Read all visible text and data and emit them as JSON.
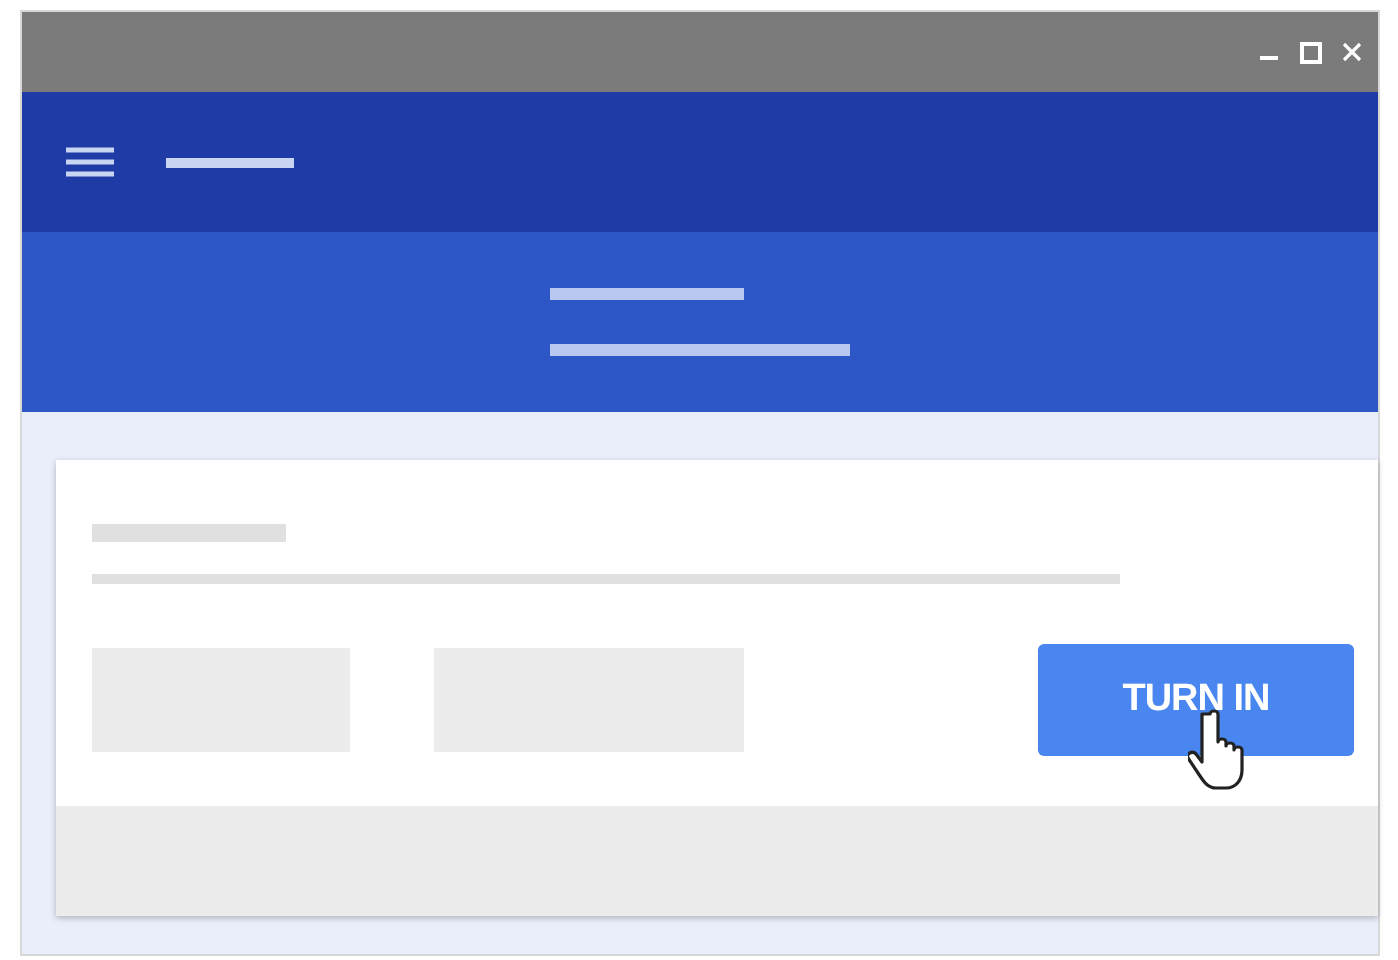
{
  "assignment_card": {
    "turn_in_button": {
      "label": "TURN IN"
    }
  }
}
